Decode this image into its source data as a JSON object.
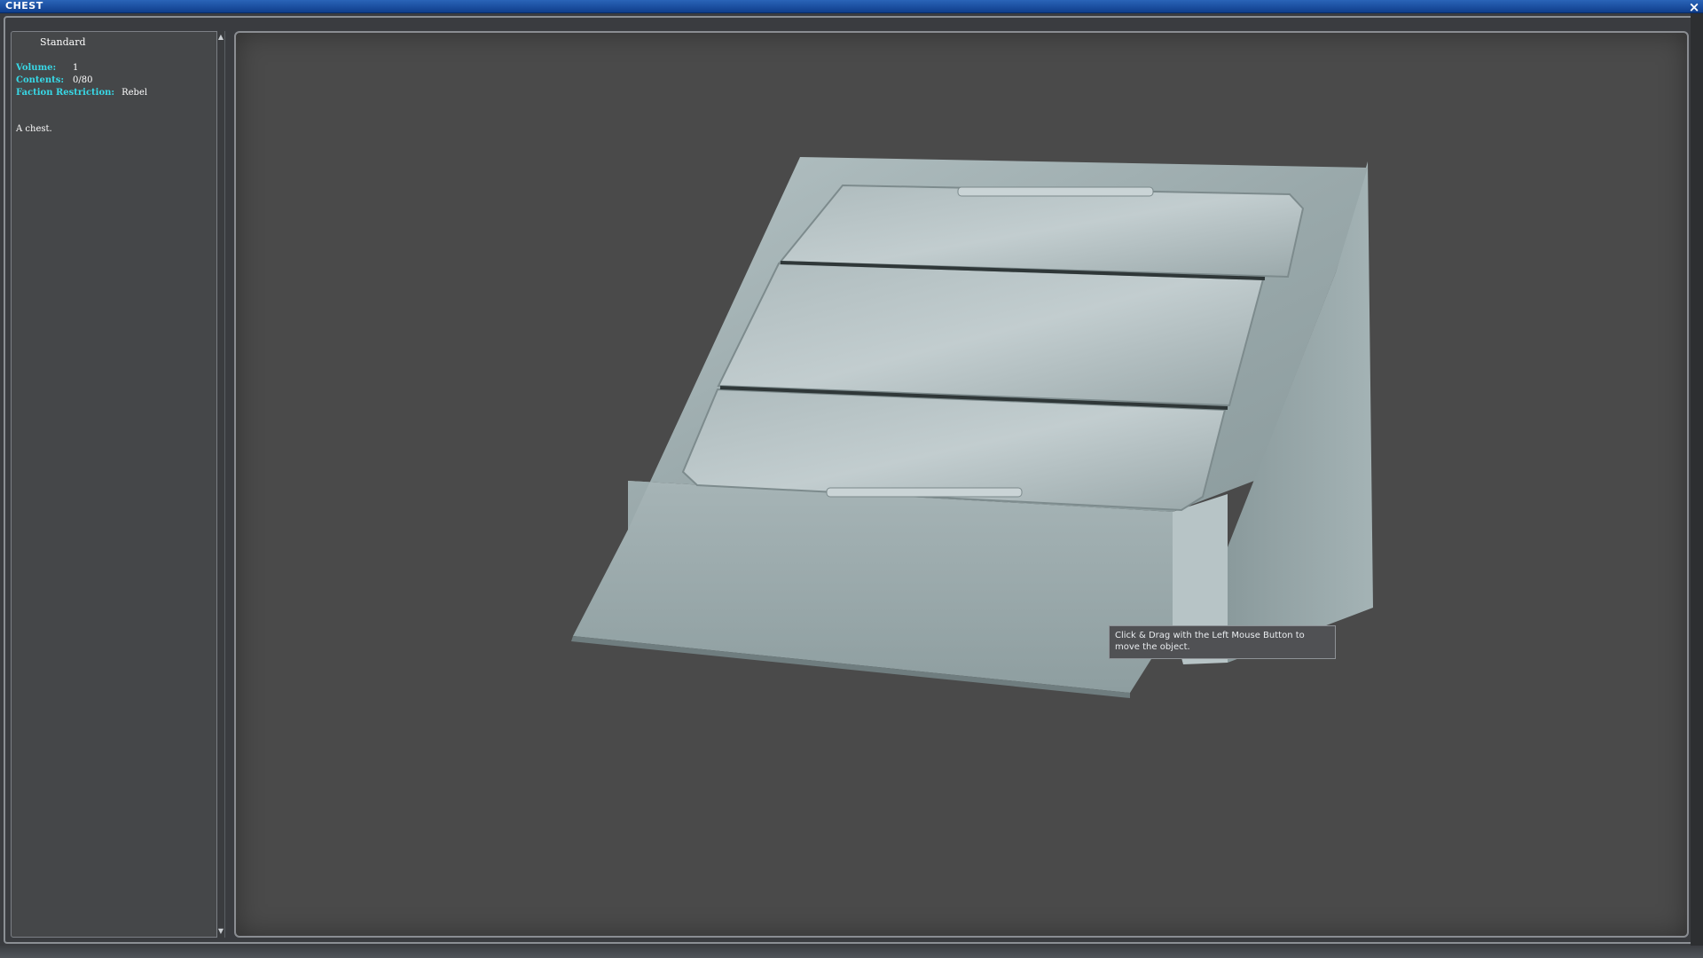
{
  "window": {
    "title": "CHEST",
    "close_label": "×"
  },
  "panel": {
    "heading": "Standard",
    "stats": [
      {
        "label": "Volume:",
        "value": "1"
      },
      {
        "label": "Contents:",
        "value": "0/80"
      },
      {
        "label": "Faction Restriction:",
        "value": "Rebel"
      }
    ],
    "description": "A chest."
  },
  "viewport": {
    "tooltip": "Click & Drag with the Left Mouse Button to move the object.",
    "background_color": "#4a4a4a",
    "object_color": "#9fb0b3"
  }
}
